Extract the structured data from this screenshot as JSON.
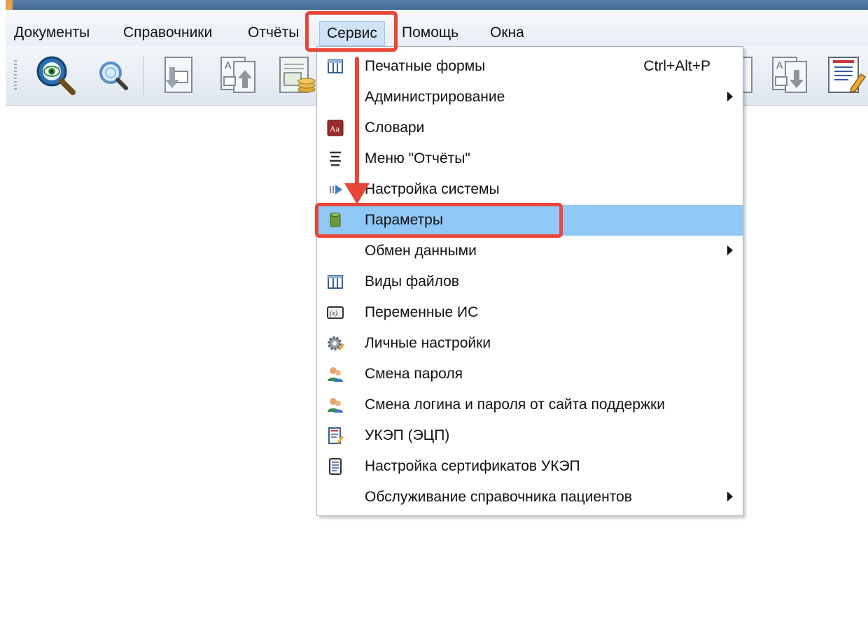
{
  "menubar": {
    "items": [
      {
        "label": "Документы"
      },
      {
        "label": "Справочники"
      },
      {
        "label": "Отчёты"
      },
      {
        "label": "Сервис"
      },
      {
        "label": "Помощь"
      },
      {
        "label": "Окна"
      }
    ],
    "active_item": "Сервис"
  },
  "toolbar": {
    "buttons": [
      {
        "icon": "eye-magnifier-icon"
      },
      {
        "icon": "search-icon"
      },
      {
        "icon": "document-import-icon"
      },
      {
        "icon": "document-export-icon"
      },
      {
        "icon": "document-coins-icon"
      },
      {
        "icon": "document-text-icon"
      },
      {
        "icon": "document-download-icon"
      },
      {
        "icon": "document-edit-icon"
      }
    ]
  },
  "service_menu": {
    "items": [
      {
        "label": "Печатные формы",
        "shortcut": "Ctrl+Alt+P",
        "icon": "table-grid-icon",
        "submenu": false
      },
      {
        "label": "Администрирование",
        "shortcut": "",
        "icon": "",
        "submenu": true
      },
      {
        "label": "Словари",
        "shortcut": "",
        "icon": "dictionary-icon",
        "submenu": false
      },
      {
        "label": "Меню \"Отчёты\"",
        "shortcut": "",
        "icon": "menu-lines-icon",
        "submenu": false
      },
      {
        "label": "Настройка системы",
        "shortcut": "",
        "icon": "system-arrow-icon",
        "submenu": false
      },
      {
        "label": "Параметры",
        "shortcut": "",
        "icon": "database-icon",
        "submenu": false,
        "highlighted": true
      },
      {
        "label": "Обмен данными",
        "shortcut": "",
        "icon": "",
        "submenu": true
      },
      {
        "label": "Виды файлов",
        "shortcut": "",
        "icon": "table-grid-icon",
        "submenu": false
      },
      {
        "label": "Переменные ИС",
        "shortcut": "",
        "icon": "variable-x-icon",
        "submenu": false
      },
      {
        "label": "Личные настройки",
        "shortcut": "",
        "icon": "gear-icon",
        "submenu": false
      },
      {
        "label": "Смена пароля",
        "shortcut": "",
        "icon": "users-icon",
        "submenu": false
      },
      {
        "label": "Смена логина и пароля от сайта поддержки",
        "shortcut": "",
        "icon": "users-icon",
        "submenu": false
      },
      {
        "label": "УКЭП (ЭЦП)",
        "shortcut": "",
        "icon": "signature-doc-icon",
        "submenu": false
      },
      {
        "label": "Настройка сертификатов УКЭП",
        "shortcut": "",
        "icon": "certificate-doc-icon",
        "submenu": false
      },
      {
        "label": "Обслуживание справочника пациентов",
        "shortcut": "",
        "icon": "",
        "submenu": true
      }
    ]
  },
  "colors": {
    "highlight": "#90c8f6",
    "callout": "#e94538",
    "menu_active_bg": "#cfe3f7"
  }
}
